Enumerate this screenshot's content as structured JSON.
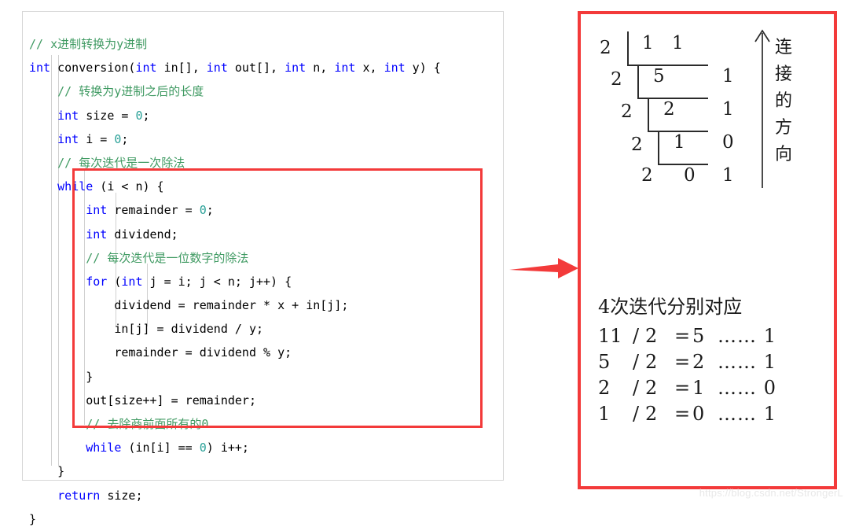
{
  "code_panel": {
    "language": "c",
    "lines": [
      {
        "indent": 0,
        "tokens": [
          {
            "t": "comment",
            "v": "// x进制转换为y进制"
          }
        ]
      },
      {
        "indent": 0,
        "tokens": [
          {
            "t": "kw",
            "v": "int"
          },
          {
            "t": "plain",
            "v": " conversion("
          },
          {
            "t": "kw",
            "v": "int"
          },
          {
            "t": "plain",
            "v": " in[], "
          },
          {
            "t": "kw",
            "v": "int"
          },
          {
            "t": "plain",
            "v": " out[], "
          },
          {
            "t": "kw",
            "v": "int"
          },
          {
            "t": "plain",
            "v": " n, "
          },
          {
            "t": "kw",
            "v": "int"
          },
          {
            "t": "plain",
            "v": " x, "
          },
          {
            "t": "kw",
            "v": "int"
          },
          {
            "t": "plain",
            "v": " y) {"
          }
        ]
      },
      {
        "indent": 1,
        "tokens": [
          {
            "t": "comment",
            "v": "// 转换为y进制之后的长度"
          }
        ]
      },
      {
        "indent": 1,
        "tokens": [
          {
            "t": "kw",
            "v": "int"
          },
          {
            "t": "plain",
            "v": " size = "
          },
          {
            "t": "num",
            "v": "0"
          },
          {
            "t": "plain",
            "v": ";"
          }
        ]
      },
      {
        "indent": 1,
        "tokens": [
          {
            "t": "kw",
            "v": "int"
          },
          {
            "t": "plain",
            "v": " i = "
          },
          {
            "t": "num",
            "v": "0"
          },
          {
            "t": "plain",
            "v": ";"
          }
        ]
      },
      {
        "indent": 1,
        "tokens": [
          {
            "t": "comment",
            "v": "// 每次迭代是一次除法"
          }
        ]
      },
      {
        "indent": 1,
        "tokens": [
          {
            "t": "kw",
            "v": "while"
          },
          {
            "t": "plain",
            "v": " (i < n) {"
          }
        ]
      },
      {
        "indent": 2,
        "tokens": [
          {
            "t": "kw",
            "v": "int"
          },
          {
            "t": "plain",
            "v": " remainder = "
          },
          {
            "t": "num",
            "v": "0"
          },
          {
            "t": "plain",
            "v": ";"
          }
        ]
      },
      {
        "indent": 2,
        "tokens": [
          {
            "t": "kw",
            "v": "int"
          },
          {
            "t": "plain",
            "v": " dividend;"
          }
        ]
      },
      {
        "indent": 2,
        "tokens": [
          {
            "t": "comment",
            "v": "// 每次迭代是一位数字的除法"
          }
        ]
      },
      {
        "indent": 2,
        "tokens": [
          {
            "t": "kw",
            "v": "for"
          },
          {
            "t": "plain",
            "v": " ("
          },
          {
            "t": "kw",
            "v": "int"
          },
          {
            "t": "plain",
            "v": " j = i; j < n; j++) {"
          }
        ]
      },
      {
        "indent": 3,
        "tokens": [
          {
            "t": "plain",
            "v": "dividend = remainder * x + in[j];"
          }
        ]
      },
      {
        "indent": 3,
        "tokens": [
          {
            "t": "plain",
            "v": "in[j] = dividend / y;"
          }
        ]
      },
      {
        "indent": 3,
        "tokens": [
          {
            "t": "plain",
            "v": "remainder = dividend % y;"
          }
        ]
      },
      {
        "indent": 2,
        "tokens": [
          {
            "t": "plain",
            "v": "}"
          }
        ]
      },
      {
        "indent": 2,
        "tokens": [
          {
            "t": "plain",
            "v": "out[size++] = remainder;"
          }
        ]
      },
      {
        "indent": 2,
        "tokens": [
          {
            "t": "comment",
            "v": "// 去除商前面所有的0"
          }
        ]
      },
      {
        "indent": 2,
        "tokens": [
          {
            "t": "kw",
            "v": "while"
          },
          {
            "t": "plain",
            "v": " (in[i] == "
          },
          {
            "t": "num",
            "v": "0"
          },
          {
            "t": "plain",
            "v": ") i++;"
          }
        ]
      },
      {
        "indent": 1,
        "tokens": [
          {
            "t": "plain",
            "v": "}"
          }
        ]
      },
      {
        "indent": 1,
        "tokens": [
          {
            "t": "kw",
            "v": "return"
          },
          {
            "t": "plain",
            "v": " size;"
          }
        ]
      },
      {
        "indent": 0,
        "tokens": [
          {
            "t": "plain",
            "v": "}"
          }
        ]
      }
    ],
    "highlight_note": "while-loop body highlighted with red rectangle"
  },
  "colors": {
    "accent_red": "#f33a3a",
    "keyword_blue": "#0000ff",
    "comment_green": "#3f9a62",
    "number_teal": "#2aa198",
    "panel_border": "#d6d6d6",
    "figure_ink": "#2b2b2b",
    "watermark_gray": "#e8e8e8"
  },
  "diagram_panel": {
    "division": {
      "title_hidden": "",
      "rows": [
        {
          "divisor": "2",
          "dividend": "1 1",
          "remainder": ""
        },
        {
          "divisor": "2",
          "dividend": "5",
          "remainder": "1"
        },
        {
          "divisor": "2",
          "dividend": "2",
          "remainder": "1"
        },
        {
          "divisor": "2",
          "dividend": "1",
          "remainder": "0"
        },
        {
          "divisor": "2",
          "dividend": "0",
          "remainder": "1"
        }
      ],
      "digits": {
        "d0a": "2",
        "d0b": "1",
        "d0c": "1",
        "d1a": "2",
        "d1b": "5",
        "d1r": "1",
        "d2a": "2",
        "d2b": "2",
        "d2r": "1",
        "d3a": "2",
        "d3b": "1",
        "d3r": "0",
        "d4a": "2",
        "d4b": "0",
        "d4r": "1"
      }
    },
    "direction_caption": [
      "连",
      "接",
      "的",
      "方",
      "向"
    ],
    "iterations": {
      "title": "4次迭代分别对应",
      "rows": [
        {
          "a": "11",
          "op": "/",
          "b": "2",
          "eq": "=",
          "q": "5",
          "dots": "……",
          "r": "1"
        },
        {
          "a": "5",
          "op": "/",
          "b": "2",
          "eq": "=",
          "q": "2",
          "dots": "……",
          "r": "1"
        },
        {
          "a": "2",
          "op": "/",
          "b": "2",
          "eq": "=",
          "q": "1",
          "dots": "……",
          "r": "0"
        },
        {
          "a": "1",
          "op": "/",
          "b": "2",
          "eq": "=",
          "q": "0",
          "dots": "……",
          "r": "1"
        }
      ]
    }
  },
  "watermark": {
    "text": "https://blog.csdn.net/StrongerL"
  }
}
